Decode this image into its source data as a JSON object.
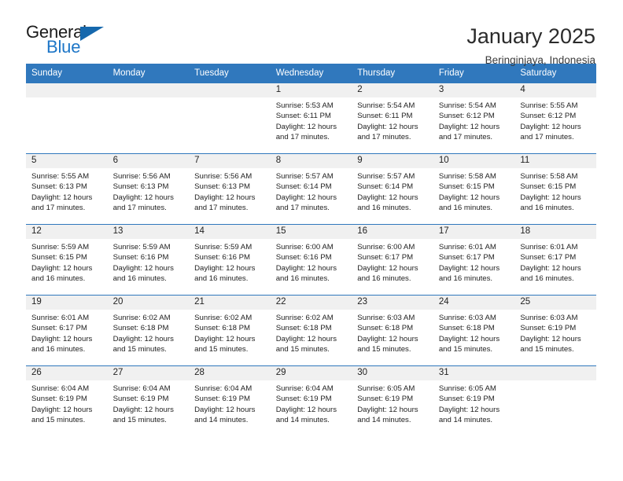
{
  "brand": {
    "name_part1": "General",
    "name_part2": "Blue",
    "triangle_icon": "triangle-icon",
    "accent_color": "#1d76c7"
  },
  "header": {
    "title": "January 2025",
    "location": "Beringinjaya, Indonesia"
  },
  "calendar": {
    "header_color": "#3078bd",
    "weekday_headers": [
      "Sunday",
      "Monday",
      "Tuesday",
      "Wednesday",
      "Thursday",
      "Friday",
      "Saturday"
    ],
    "weeks": [
      [
        {
          "empty": true,
          "day": "",
          "sunrise": "",
          "sunset": "",
          "daylight1": "",
          "daylight2": ""
        },
        {
          "empty": true,
          "day": "",
          "sunrise": "",
          "sunset": "",
          "daylight1": "",
          "daylight2": ""
        },
        {
          "empty": true,
          "day": "",
          "sunrise": "",
          "sunset": "",
          "daylight1": "",
          "daylight2": ""
        },
        {
          "empty": false,
          "day": "1",
          "sunrise": "Sunrise: 5:53 AM",
          "sunset": "Sunset: 6:11 PM",
          "daylight1": "Daylight: 12 hours",
          "daylight2": "and 17 minutes."
        },
        {
          "empty": false,
          "day": "2",
          "sunrise": "Sunrise: 5:54 AM",
          "sunset": "Sunset: 6:11 PM",
          "daylight1": "Daylight: 12 hours",
          "daylight2": "and 17 minutes."
        },
        {
          "empty": false,
          "day": "3",
          "sunrise": "Sunrise: 5:54 AM",
          "sunset": "Sunset: 6:12 PM",
          "daylight1": "Daylight: 12 hours",
          "daylight2": "and 17 minutes."
        },
        {
          "empty": false,
          "day": "4",
          "sunrise": "Sunrise: 5:55 AM",
          "sunset": "Sunset: 6:12 PM",
          "daylight1": "Daylight: 12 hours",
          "daylight2": "and 17 minutes."
        }
      ],
      [
        {
          "empty": false,
          "day": "5",
          "sunrise": "Sunrise: 5:55 AM",
          "sunset": "Sunset: 6:13 PM",
          "daylight1": "Daylight: 12 hours",
          "daylight2": "and 17 minutes."
        },
        {
          "empty": false,
          "day": "6",
          "sunrise": "Sunrise: 5:56 AM",
          "sunset": "Sunset: 6:13 PM",
          "daylight1": "Daylight: 12 hours",
          "daylight2": "and 17 minutes."
        },
        {
          "empty": false,
          "day": "7",
          "sunrise": "Sunrise: 5:56 AM",
          "sunset": "Sunset: 6:13 PM",
          "daylight1": "Daylight: 12 hours",
          "daylight2": "and 17 minutes."
        },
        {
          "empty": false,
          "day": "8",
          "sunrise": "Sunrise: 5:57 AM",
          "sunset": "Sunset: 6:14 PM",
          "daylight1": "Daylight: 12 hours",
          "daylight2": "and 17 minutes."
        },
        {
          "empty": false,
          "day": "9",
          "sunrise": "Sunrise: 5:57 AM",
          "sunset": "Sunset: 6:14 PM",
          "daylight1": "Daylight: 12 hours",
          "daylight2": "and 16 minutes."
        },
        {
          "empty": false,
          "day": "10",
          "sunrise": "Sunrise: 5:58 AM",
          "sunset": "Sunset: 6:15 PM",
          "daylight1": "Daylight: 12 hours",
          "daylight2": "and 16 minutes."
        },
        {
          "empty": false,
          "day": "11",
          "sunrise": "Sunrise: 5:58 AM",
          "sunset": "Sunset: 6:15 PM",
          "daylight1": "Daylight: 12 hours",
          "daylight2": "and 16 minutes."
        }
      ],
      [
        {
          "empty": false,
          "day": "12",
          "sunrise": "Sunrise: 5:59 AM",
          "sunset": "Sunset: 6:15 PM",
          "daylight1": "Daylight: 12 hours",
          "daylight2": "and 16 minutes."
        },
        {
          "empty": false,
          "day": "13",
          "sunrise": "Sunrise: 5:59 AM",
          "sunset": "Sunset: 6:16 PM",
          "daylight1": "Daylight: 12 hours",
          "daylight2": "and 16 minutes."
        },
        {
          "empty": false,
          "day": "14",
          "sunrise": "Sunrise: 5:59 AM",
          "sunset": "Sunset: 6:16 PM",
          "daylight1": "Daylight: 12 hours",
          "daylight2": "and 16 minutes."
        },
        {
          "empty": false,
          "day": "15",
          "sunrise": "Sunrise: 6:00 AM",
          "sunset": "Sunset: 6:16 PM",
          "daylight1": "Daylight: 12 hours",
          "daylight2": "and 16 minutes."
        },
        {
          "empty": false,
          "day": "16",
          "sunrise": "Sunrise: 6:00 AM",
          "sunset": "Sunset: 6:17 PM",
          "daylight1": "Daylight: 12 hours",
          "daylight2": "and 16 minutes."
        },
        {
          "empty": false,
          "day": "17",
          "sunrise": "Sunrise: 6:01 AM",
          "sunset": "Sunset: 6:17 PM",
          "daylight1": "Daylight: 12 hours",
          "daylight2": "and 16 minutes."
        },
        {
          "empty": false,
          "day": "18",
          "sunrise": "Sunrise: 6:01 AM",
          "sunset": "Sunset: 6:17 PM",
          "daylight1": "Daylight: 12 hours",
          "daylight2": "and 16 minutes."
        }
      ],
      [
        {
          "empty": false,
          "day": "19",
          "sunrise": "Sunrise: 6:01 AM",
          "sunset": "Sunset: 6:17 PM",
          "daylight1": "Daylight: 12 hours",
          "daylight2": "and 16 minutes."
        },
        {
          "empty": false,
          "day": "20",
          "sunrise": "Sunrise: 6:02 AM",
          "sunset": "Sunset: 6:18 PM",
          "daylight1": "Daylight: 12 hours",
          "daylight2": "and 15 minutes."
        },
        {
          "empty": false,
          "day": "21",
          "sunrise": "Sunrise: 6:02 AM",
          "sunset": "Sunset: 6:18 PM",
          "daylight1": "Daylight: 12 hours",
          "daylight2": "and 15 minutes."
        },
        {
          "empty": false,
          "day": "22",
          "sunrise": "Sunrise: 6:02 AM",
          "sunset": "Sunset: 6:18 PM",
          "daylight1": "Daylight: 12 hours",
          "daylight2": "and 15 minutes."
        },
        {
          "empty": false,
          "day": "23",
          "sunrise": "Sunrise: 6:03 AM",
          "sunset": "Sunset: 6:18 PM",
          "daylight1": "Daylight: 12 hours",
          "daylight2": "and 15 minutes."
        },
        {
          "empty": false,
          "day": "24",
          "sunrise": "Sunrise: 6:03 AM",
          "sunset": "Sunset: 6:18 PM",
          "daylight1": "Daylight: 12 hours",
          "daylight2": "and 15 minutes."
        },
        {
          "empty": false,
          "day": "25",
          "sunrise": "Sunrise: 6:03 AM",
          "sunset": "Sunset: 6:19 PM",
          "daylight1": "Daylight: 12 hours",
          "daylight2": "and 15 minutes."
        }
      ],
      [
        {
          "empty": false,
          "day": "26",
          "sunrise": "Sunrise: 6:04 AM",
          "sunset": "Sunset: 6:19 PM",
          "daylight1": "Daylight: 12 hours",
          "daylight2": "and 15 minutes."
        },
        {
          "empty": false,
          "day": "27",
          "sunrise": "Sunrise: 6:04 AM",
          "sunset": "Sunset: 6:19 PM",
          "daylight1": "Daylight: 12 hours",
          "daylight2": "and 15 minutes."
        },
        {
          "empty": false,
          "day": "28",
          "sunrise": "Sunrise: 6:04 AM",
          "sunset": "Sunset: 6:19 PM",
          "daylight1": "Daylight: 12 hours",
          "daylight2": "and 14 minutes."
        },
        {
          "empty": false,
          "day": "29",
          "sunrise": "Sunrise: 6:04 AM",
          "sunset": "Sunset: 6:19 PM",
          "daylight1": "Daylight: 12 hours",
          "daylight2": "and 14 minutes."
        },
        {
          "empty": false,
          "day": "30",
          "sunrise": "Sunrise: 6:05 AM",
          "sunset": "Sunset: 6:19 PM",
          "daylight1": "Daylight: 12 hours",
          "daylight2": "and 14 minutes."
        },
        {
          "empty": false,
          "day": "31",
          "sunrise": "Sunrise: 6:05 AM",
          "sunset": "Sunset: 6:19 PM",
          "daylight1": "Daylight: 12 hours",
          "daylight2": "and 14 minutes."
        },
        {
          "empty": true,
          "day": "",
          "sunrise": "",
          "sunset": "",
          "daylight1": "",
          "daylight2": ""
        }
      ]
    ]
  }
}
